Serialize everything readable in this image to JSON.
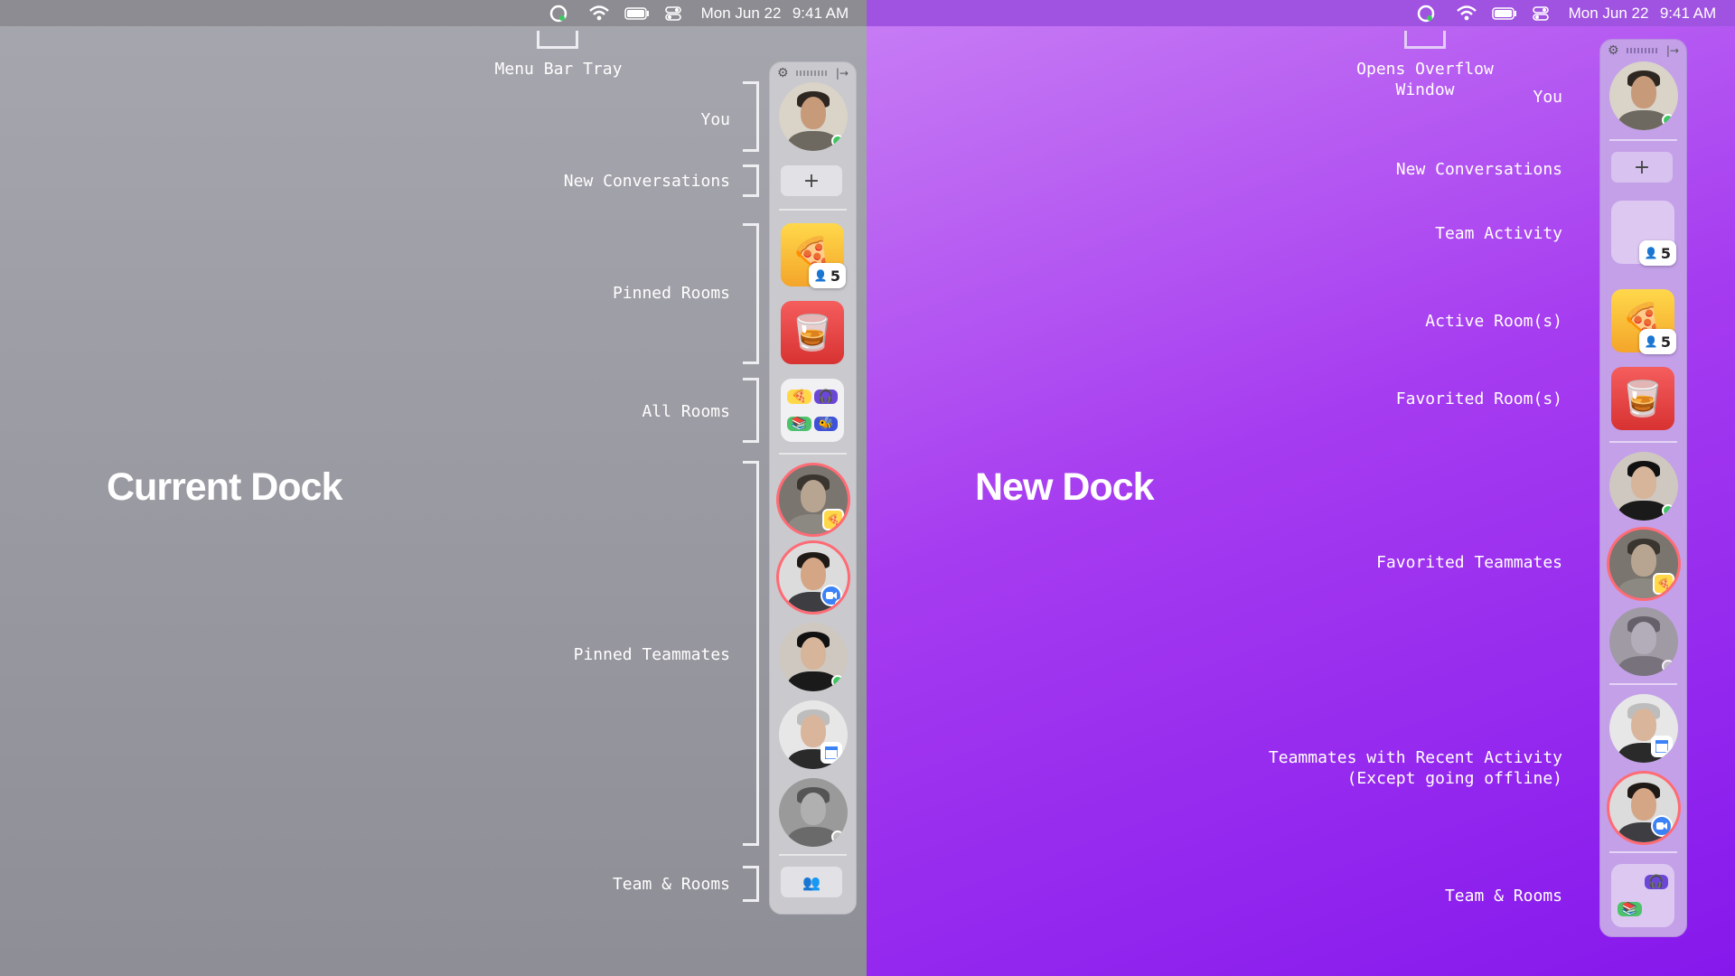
{
  "menubar": {
    "date": "Mon Jun 22",
    "time": "9:41 AM",
    "icons": [
      "app-status-icon",
      "wifi-icon",
      "battery-icon",
      "control-center-icon"
    ]
  },
  "left": {
    "title": "Current Dock",
    "top_annotation": "Menu Bar Tray",
    "labels": {
      "you": "You",
      "new_conversations": "New Conversations",
      "pinned_rooms": "Pinned Rooms",
      "all_rooms": "All Rooms",
      "pinned_teammates": "Pinned Teammates",
      "team_rooms": "Team & Rooms"
    },
    "pizza_room_count": "5"
  },
  "right": {
    "title": "New Dock",
    "top_annotation_line1": "Opens Overflow",
    "top_annotation_line2": "Window",
    "labels": {
      "you": "You",
      "new_conversations": "New Conversations",
      "team_activity": "Team Activity",
      "active_rooms": "Active Room(s)",
      "favorited_rooms": "Favorited Room(s)",
      "favorited_teammates": "Favorited Teammates",
      "recent_activity_line1": "Teammates with Recent Activity",
      "recent_activity_line2": "(Except going offline)",
      "team_rooms": "Team & Rooms"
    },
    "team_activity_count": "5",
    "pizza_room_count": "5"
  },
  "dock": {
    "plus": "+",
    "people_icon": "👥",
    "pizza_emoji": "🍕",
    "whiskey_emoji": "🥃",
    "headphones_emoji": "🎧",
    "books_emoji": "📚",
    "bee_emoji": "🐝",
    "person_glyph": "👤",
    "gear": "⚙",
    "collapse": "|→"
  },
  "colors": {
    "left_bg": "#9c9ca4",
    "right_bg": "#9a2cf0",
    "online": "#3cc760",
    "ring": "#ff6b74"
  }
}
